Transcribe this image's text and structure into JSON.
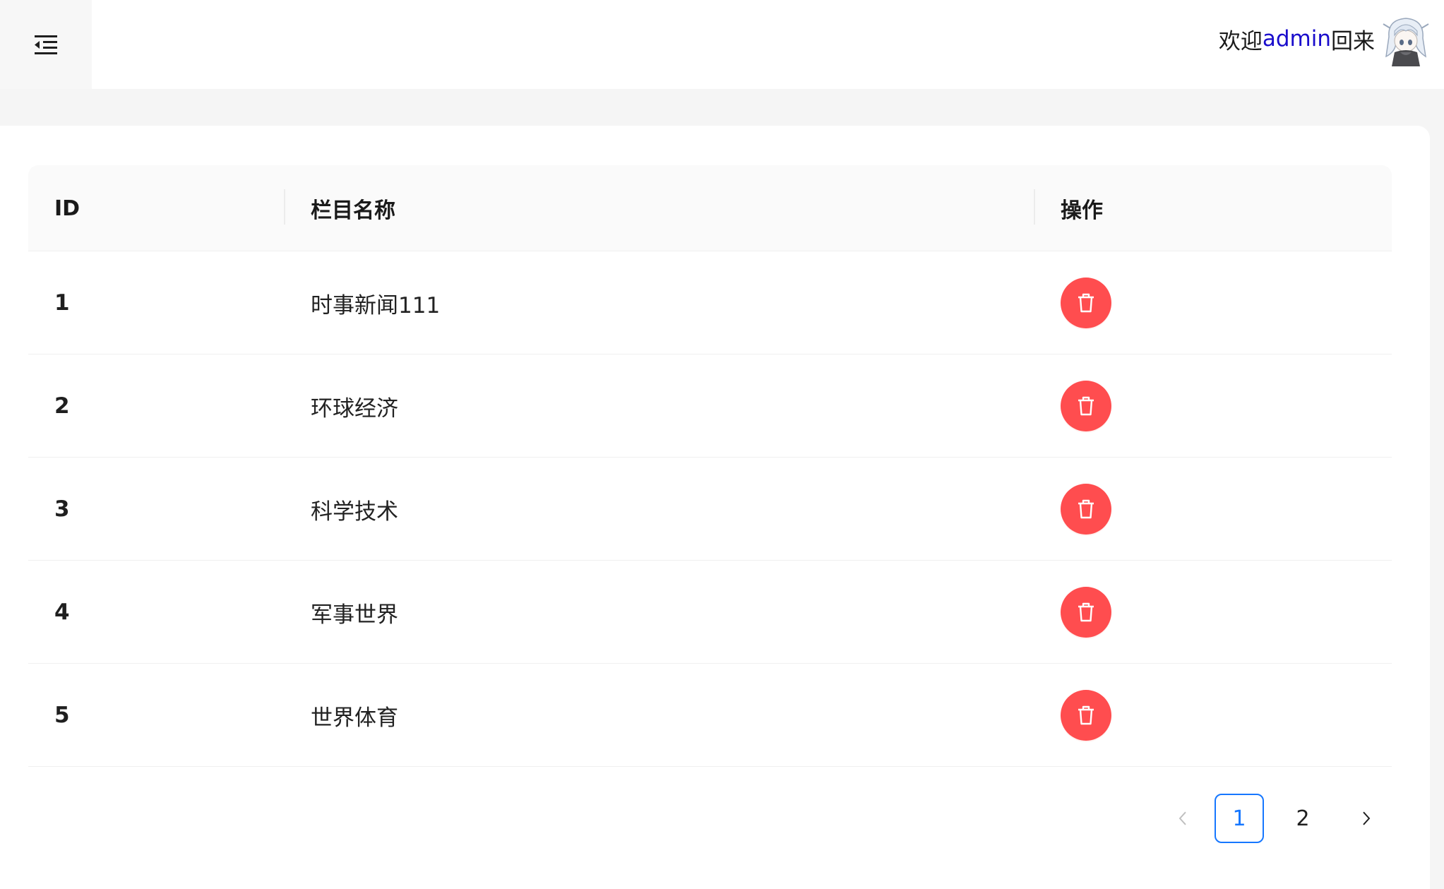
{
  "header": {
    "welcome_prefix": "欢迎",
    "username": "admin",
    "welcome_suffix": "回来"
  },
  "table": {
    "columns": [
      "ID",
      "栏目名称",
      "操作"
    ],
    "rows": [
      {
        "id": "1",
        "name": "时事新闻111"
      },
      {
        "id": "2",
        "name": "环球经济"
      },
      {
        "id": "3",
        "name": "科学技术"
      },
      {
        "id": "4",
        "name": "军事世界"
      },
      {
        "id": "5",
        "name": "世界体育"
      }
    ]
  },
  "pagination": {
    "pages": [
      "1",
      "2"
    ],
    "current": "1"
  },
  "colors": {
    "danger": "#ff4d4f",
    "primary": "#1677ff",
    "username": "#1a0dcc"
  }
}
